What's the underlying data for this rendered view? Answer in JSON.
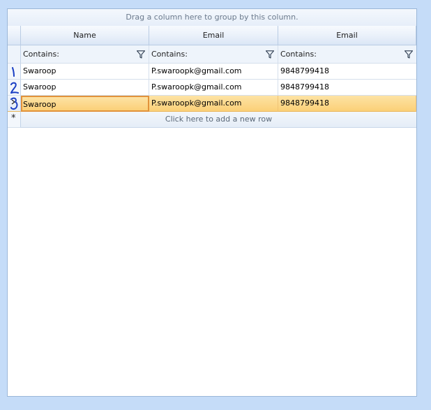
{
  "group_panel": {
    "text": "Drag a column here to group by this column."
  },
  "columns": [
    {
      "header": "Name",
      "filter": "Contains:"
    },
    {
      "header": "Email",
      "filter": "Contains:"
    },
    {
      "header": "Email",
      "filter": "Contains:"
    }
  ],
  "rows": [
    {
      "cells": [
        "Swaroop",
        "P.swaroopk@gmail.com",
        "9848799418"
      ],
      "marker": "1"
    },
    {
      "cells": [
        "Swaroop",
        "P.swaroopk@gmail.com",
        "9848799418"
      ],
      "marker": "2"
    },
    {
      "cells": [
        "Swaroop",
        "P.swaroopk@gmail.com",
        "9848799418"
      ],
      "marker": "3"
    }
  ],
  "selected_row": 2,
  "new_row": {
    "text": "Click here to add a new row",
    "symbol": "*"
  },
  "icons": {
    "filter": "filter-funnel-icon",
    "current_row": "current-row-arrow-icon",
    "new_row": "new-row-star-icon"
  },
  "colors": {
    "selection": "#fbd078",
    "selection_border": "#e2923a",
    "annotation_ink": "#1a3fc4",
    "background": "#c5dcf8"
  }
}
